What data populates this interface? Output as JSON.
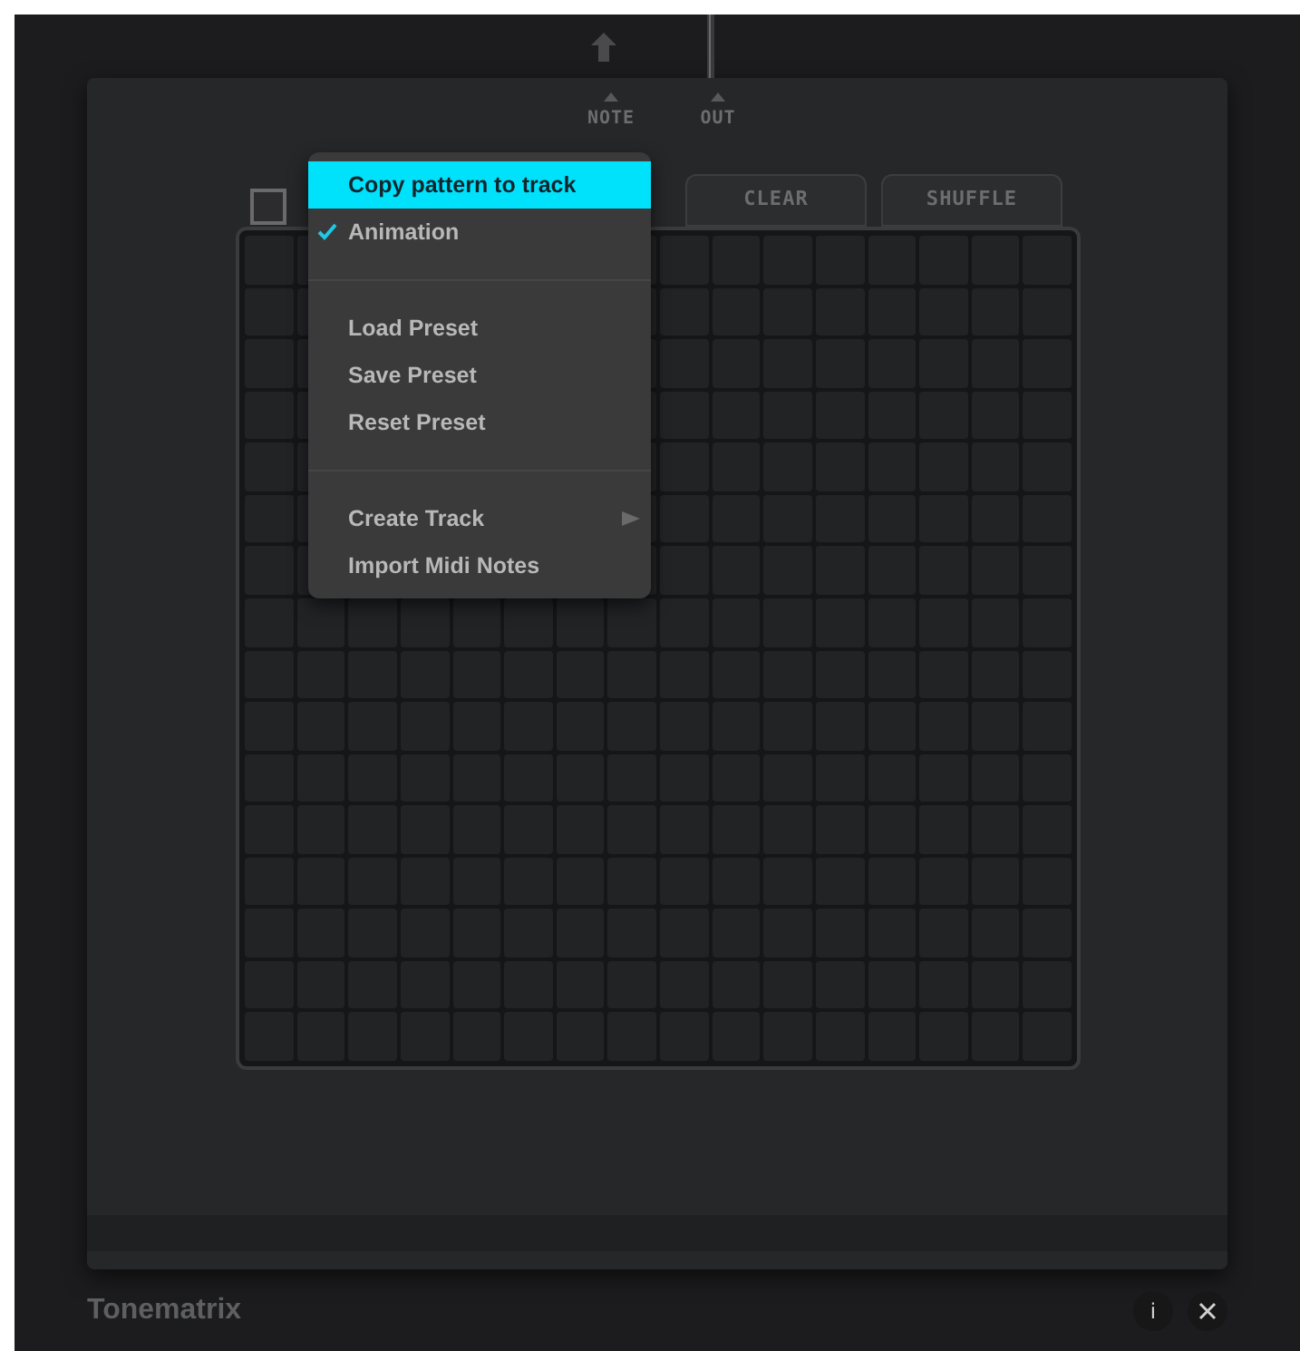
{
  "jacks": [
    {
      "label": "NOTE"
    },
    {
      "label": "OUT"
    }
  ],
  "pattern_checkbox": {
    "checked": false
  },
  "tabs": [
    {
      "label": "CLEAR"
    },
    {
      "label": "SHUFFLE"
    }
  ],
  "menu": [
    {
      "kind": "item",
      "label": "Copy pattern to track",
      "selected": true,
      "checked": false,
      "submenu": false
    },
    {
      "kind": "item",
      "label": "Animation",
      "selected": false,
      "checked": true,
      "submenu": false
    },
    {
      "kind": "separator"
    },
    {
      "kind": "item",
      "label": "Load Preset",
      "selected": false,
      "checked": false,
      "submenu": false
    },
    {
      "kind": "item",
      "label": "Save Preset",
      "selected": false,
      "checked": false,
      "submenu": false
    },
    {
      "kind": "item",
      "label": "Reset Preset",
      "selected": false,
      "checked": false,
      "submenu": false
    },
    {
      "kind": "separator"
    },
    {
      "kind": "item",
      "label": "Create Track",
      "selected": false,
      "checked": false,
      "submenu": true
    },
    {
      "kind": "item",
      "label": "Import Midi Notes",
      "selected": false,
      "checked": false,
      "submenu": false
    }
  ],
  "footer": {
    "title": "Tonematrix",
    "info_button": "i"
  }
}
